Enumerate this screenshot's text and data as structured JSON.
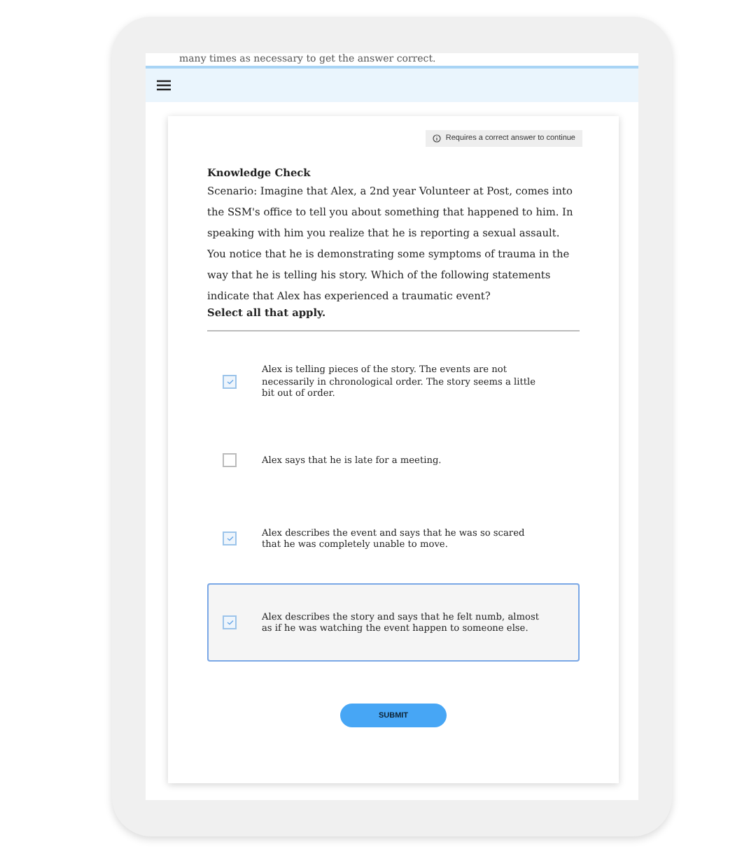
{
  "top_text": "many times as necessary to get the answer correct.",
  "notice": "Requires a correct answer to continue",
  "question": {
    "title": "Knowledge Check",
    "scenario": "Scenario: Imagine that Alex, a 2nd year Volunteer at Post, comes into the SSM's office to tell you about something that happened to him.  In speaking with him you realize that he is reporting a sexual assault. You notice that he is demonstrating some symptoms of trauma in the way that he is telling his story. Which of the following statements indicate that Alex has experienced a traumatic event?",
    "instruction": "Select all that apply."
  },
  "options": [
    {
      "label": "Alex is telling pieces of the story. The events are not necessarily in chronological order. The story seems a little bit out of order.",
      "checked": true,
      "focused": false
    },
    {
      "label": "Alex says that he is late for a meeting.",
      "checked": false,
      "focused": false
    },
    {
      "label": "Alex describes the event and says that he was so scared that he was completely unable to move.",
      "checked": true,
      "focused": false
    },
    {
      "label": "Alex describes the story and says that he felt numb, almost as if he was watching the event happen to someone else.",
      "checked": true,
      "focused": true
    }
  ],
  "submit": "SUBMIT"
}
